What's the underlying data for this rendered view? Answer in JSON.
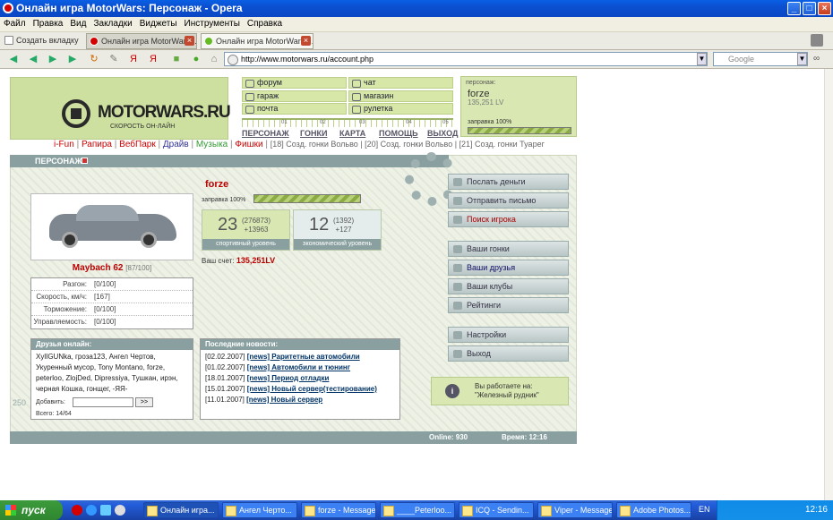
{
  "window": {
    "title": "Онлайн игра MotorWars: Персонаж - Opera",
    "buttons": [
      "_",
      "□",
      "×"
    ]
  },
  "menu": [
    "Файл",
    "Правка",
    "Вид",
    "Закладки",
    "Виджеты",
    "Инструменты",
    "Справка"
  ],
  "tabs": {
    "new_tab": "Создать вкладку",
    "items": [
      "Онлайн игра MotorWars: ...",
      "Онлайн игра MotorWars: ..."
    ]
  },
  "address": {
    "url": "http://www.motorwars.ru/account.php",
    "search_placeholder": "Google"
  },
  "site": {
    "logo": {
      "text": "MOTORWARS.RU",
      "sub": "СКОРОСТЬ ОН-ЛАЙН"
    },
    "nav": [
      "форум",
      "чат",
      "гараж",
      "магазин",
      "почта",
      "рулетка"
    ],
    "ruler_ticks": [
      "01",
      "02",
      "03",
      "04",
      "05"
    ],
    "top_links": [
      "ПЕРСОНАЖ",
      "ГОНКИ",
      "КАРТА",
      "ПОМОЩЬ",
      "ВЫХОД"
    ],
    "char_panel": {
      "label": "персонаж:",
      "name": "forze",
      "money": "135,251 LV",
      "fuel": "заправка 100%",
      "fuel_level": 1.0
    },
    "partner_links": [
      "i-Fun",
      "Рапира",
      "ВебПарк",
      "Драйв",
      "Музыка",
      "Фишки"
    ],
    "game_links": "[18] Созд. гонки Вольво | [20] Созд. гонки Вольво | [21] Созд. гонки Туарег",
    "section_title": "ПЕРСОНАЖ",
    "car": {
      "name": "Maybach 62",
      "state": "[87/100]"
    },
    "stats": [
      {
        "k": "Разгон:",
        "v": "[0/100]"
      },
      {
        "k": "Скорость, км/ч:",
        "v": "[167]"
      },
      {
        "k": "Торможение:",
        "v": "[0/100]"
      },
      {
        "k": "Управляемость:",
        "v": "[0/100]"
      }
    ],
    "player": {
      "name": "forze",
      "fuel": "заправка 100%",
      "fuel_level": 1.0,
      "account_label": "Ваш счет:",
      "account": "135,251LV"
    },
    "levels": [
      {
        "num": "23",
        "a": "(276873)",
        "b": "+13963",
        "label": "спортивный уровень"
      },
      {
        "num": "12",
        "a": "(1392)",
        "b": "+127",
        "label": "экономический уровень"
      }
    ],
    "friends": {
      "title": "Друзья онлайн:",
      "text": "XylIGUNka, гроза123, Ангел Чертов, Укуренный мусор, Tony Montano, forze, peterloo, ZlojDed, Dipressiya, Тушкан, ирэн, черная Кошка, гонщег, -ЯЯ-",
      "add_label": "Добавить:",
      "add_btn": ">>",
      "total": "Всего: 14/64"
    },
    "news": {
      "title": "Последние новости:",
      "items": [
        {
          "date": "[02.02.2007]",
          "text": "[news] Раритетные автомобили"
        },
        {
          "date": "[01.02.2007]",
          "text": "[news] Автомобили и тюнинг"
        },
        {
          "date": "[18.01.2007]",
          "text": "[news] Период отладки"
        },
        {
          "date": "[15.01.2007]",
          "text": "[news] Новый сервер(тестирование)"
        },
        {
          "date": "[11.01.2007]",
          "text": "[news] Новый сервер"
        }
      ]
    },
    "actions": [
      "Послать деньги",
      "Отправить письмо",
      "Поиск игрока",
      "Ваши гонки",
      "Ваши друзья",
      "Ваши клубы",
      "Рейтинги",
      "Настройки",
      "Выход"
    ],
    "work": {
      "label": "Вы работаете на:",
      "place": "\"Железный рудник\""
    },
    "footer": {
      "online": "Online: 930",
      "time": "Время: 12:16"
    },
    "gauge": "250"
  },
  "taskbar": {
    "start": "пуск",
    "items": [
      "Онлайн игра...",
      "Ангел Черто...",
      "forze - Message",
      "____Peterloo...",
      "ICQ - Sendin...",
      "Viper - Message",
      "Adobe Photos..."
    ],
    "lang": "EN",
    "clock": "12:16"
  }
}
